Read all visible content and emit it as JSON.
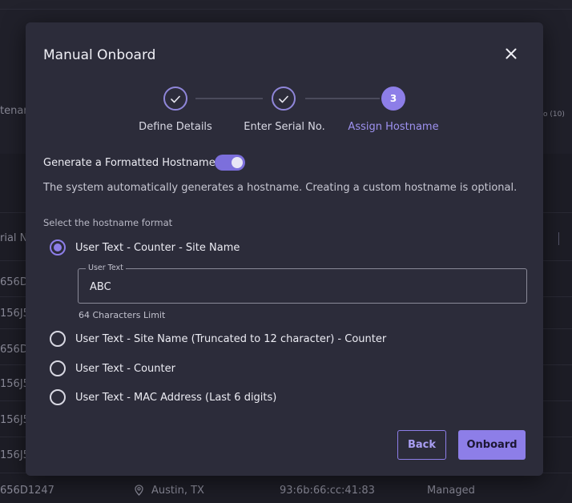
{
  "background": {
    "header_fragment": "tenan",
    "header_right_fragment": "o (10)",
    "column_fragment": "rial N",
    "row_ids": [
      "656D",
      "156J5",
      "656D",
      "156J5",
      "156J5",
      "156J5"
    ],
    "last_row": {
      "id": "656D1247",
      "location": "Austin, TX",
      "mac": "93:6b:66:cc:41:83",
      "status": "Managed"
    }
  },
  "modal": {
    "title": "Manual Onboard",
    "close_icon": "close-icon",
    "stepper": {
      "steps": [
        {
          "label": "Define Details",
          "state": "done",
          "icon": "check-icon"
        },
        {
          "label": "Enter Serial No.",
          "state": "done",
          "icon": "check-icon"
        },
        {
          "label": "Assign Hostname",
          "state": "active",
          "number": "3"
        }
      ]
    },
    "toggle": {
      "label": "Generate a Formatted Hostname",
      "on": true
    },
    "description": "The system automatically generates a hostname. Creating a custom hostname is optional.",
    "format_section_label": "Select the hostname format",
    "options": [
      {
        "label": "User Text - Counter - Site Name",
        "selected": true
      },
      {
        "label": "User Text - Site Name (Truncated to 12 character) - Counter",
        "selected": false
      },
      {
        "label": "User Text - Counter",
        "selected": false
      },
      {
        "label": "User Text - MAC Address (Last 6 digits)",
        "selected": false
      }
    ],
    "user_text_field": {
      "legend": "User Text",
      "value": "ABC",
      "helper": "64 Characters Limit"
    },
    "buttons": {
      "back": "Back",
      "onboard": "Onboard"
    }
  },
  "colors": {
    "accent": "#8d7ee8",
    "modal_bg": "#2c2c3a",
    "page_bg": "#1d1d26"
  }
}
